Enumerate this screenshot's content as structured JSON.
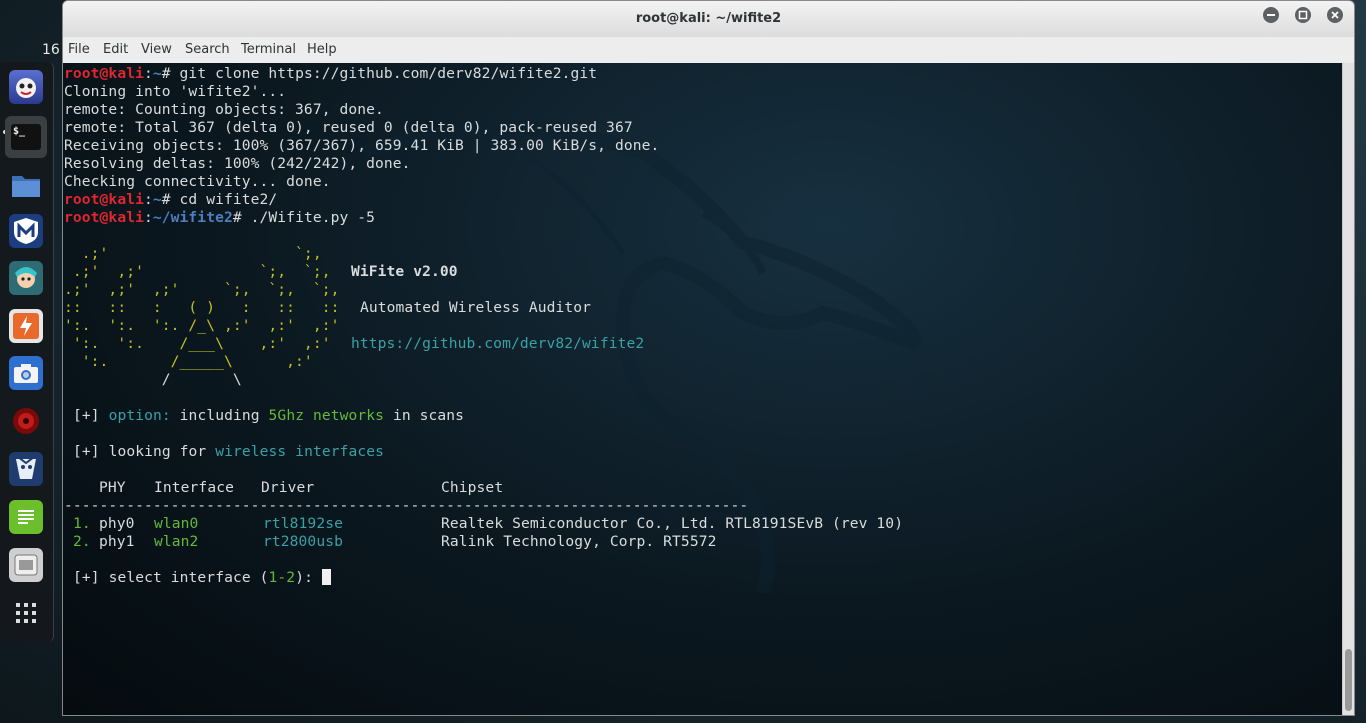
{
  "desktop": {
    "clock": "16"
  },
  "dock": {
    "items": [
      {
        "name": "kali-mascot",
        "label": ""
      },
      {
        "name": "terminal",
        "label": "$_"
      },
      {
        "name": "files",
        "label": ""
      },
      {
        "name": "metasploit",
        "label": "M"
      },
      {
        "name": "armitage",
        "label": ""
      },
      {
        "name": "burpsuite",
        "label": ""
      },
      {
        "name": "screenshot",
        "label": ""
      },
      {
        "name": "radare",
        "label": ""
      },
      {
        "name": "maltego",
        "label": ""
      },
      {
        "name": "notes",
        "label": ""
      },
      {
        "name": "settings",
        "label": ""
      },
      {
        "name": "app-grid",
        "label": ""
      }
    ]
  },
  "window": {
    "title": "root@kali: ~/wifite2",
    "menu": [
      "File",
      "Edit",
      "View",
      "Search",
      "Terminal",
      "Help"
    ]
  },
  "terminal": {
    "prompt_user": "root@kali",
    "home_dir": "~",
    "wifite_dir": "~/wifite2",
    "cmd1": "git clone https://github.com/derv82/wifite2.git",
    "out1": "Cloning into 'wifite2'...",
    "out2": "remote: Counting objects: 367, done.",
    "out3": "remote: Total 367 (delta 0), reused 0 (delta 0), pack-reused 367",
    "out4": "Receiving objects: 100% (367/367), 659.41 KiB | 383.00 KiB/s, done.",
    "out5": "Resolving deltas: 100% (242/242), done.",
    "out6": "Checking connectivity... done.",
    "cmd2": "cd wifite2/",
    "cmd3": "./Wifite.py -5",
    "banner": {
      "l1": "  .;'                     `;,",
      "l2": " .;'  ,;'             `;,  `;,",
      "l3": ".;'  ,;'  ,;'     `;,  `;,  `;,",
      "l4": "::   ::   :   ( )   :   ::   ::",
      "l5": "':.  ':.  ':. /_\\ ,:'  ,:'  ,:'",
      "l6": " ':.  ':.    /___\\    ,:'  ,:'",
      "l7": "  ':.       /_____\\      ,:'",
      "l8": "           /       \\",
      "title": "WiFite v2.00",
      "subtitle": "Automated Wireless Auditor",
      "url": "https://github.com/derv82/wifite2"
    },
    "option_prefix": "[+]",
    "option_label": "option:",
    "option_text1": "including",
    "option_highlight": "5Ghz networks",
    "option_text2": "in scans",
    "looking_text": "looking for",
    "looking_highlight": "wireless interfaces",
    "table": {
      "headers": [
        "PHY",
        "Interface",
        "Driver",
        "Chipset"
      ],
      "divider": "-----------------------------------------------------------------------------",
      "rows": [
        {
          "num": "1.",
          "phy": "phy0",
          "iface": "wlan0",
          "driver": "rtl8192se",
          "chipset": "Realtek Semiconductor Co., Ltd. RTL8191SEvB (rev 10)"
        },
        {
          "num": "2.",
          "phy": "phy1",
          "iface": "wlan2",
          "driver": "rt2800usb",
          "chipset": "Ralink Technology, Corp. RT5572"
        }
      ]
    },
    "select_text": "select interface (",
    "select_range": "1-2",
    "select_end": "):"
  }
}
